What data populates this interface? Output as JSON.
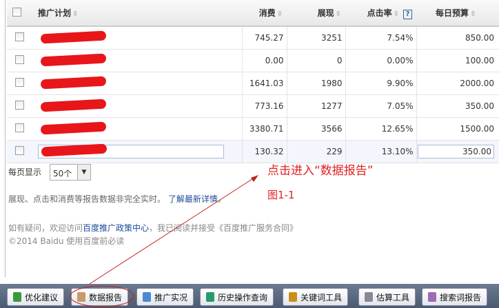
{
  "table": {
    "headers": [
      "推广计划",
      "消费",
      "展现",
      "点击率",
      "每日预算"
    ],
    "help_icon": "?",
    "rows": [
      {
        "cost": "745.27",
        "impressions": "3251",
        "ctr": "7.54%",
        "budget": "850.00"
      },
      {
        "cost": "0.00",
        "impressions": "0",
        "ctr": "0.00%",
        "budget": "100.00"
      },
      {
        "cost": "1641.03",
        "impressions": "1980",
        "ctr": "9.90%",
        "budget": "2000.00"
      },
      {
        "cost": "773.16",
        "impressions": "1277",
        "ctr": "7.05%",
        "budget": "350.00"
      },
      {
        "cost": "3380.71",
        "impressions": "3566",
        "ctr": "12.65%",
        "budget": "1500.00"
      },
      {
        "cost": "130.32",
        "impressions": "229",
        "ctr": "13.10%",
        "budget": "350.00"
      }
    ]
  },
  "pagination": {
    "label": "每页显示",
    "value": "50个"
  },
  "note": {
    "text": "展现、点击和消费等报告数据非完全实时。",
    "link": "了解最新详情"
  },
  "annotation": {
    "title": "点击进入“数据报告”",
    "figure": "图1-1"
  },
  "footer": {
    "line1_pre": "如有疑问，欢迎访问",
    "line1_link": "百度推广政策中心",
    "line1_post": "，我已阅读并接受《百度推广服务合同》",
    "line2": "©2014 Baidu 使用百度前必读"
  },
  "toolbar": [
    "优化建议",
    "数据报告",
    "推广实况",
    "历史操作查询",
    "关键词工具",
    "估算工具",
    "搜索词报告"
  ],
  "colors": {
    "annotation": "#e02020",
    "toolbar": "#4b5a70"
  }
}
